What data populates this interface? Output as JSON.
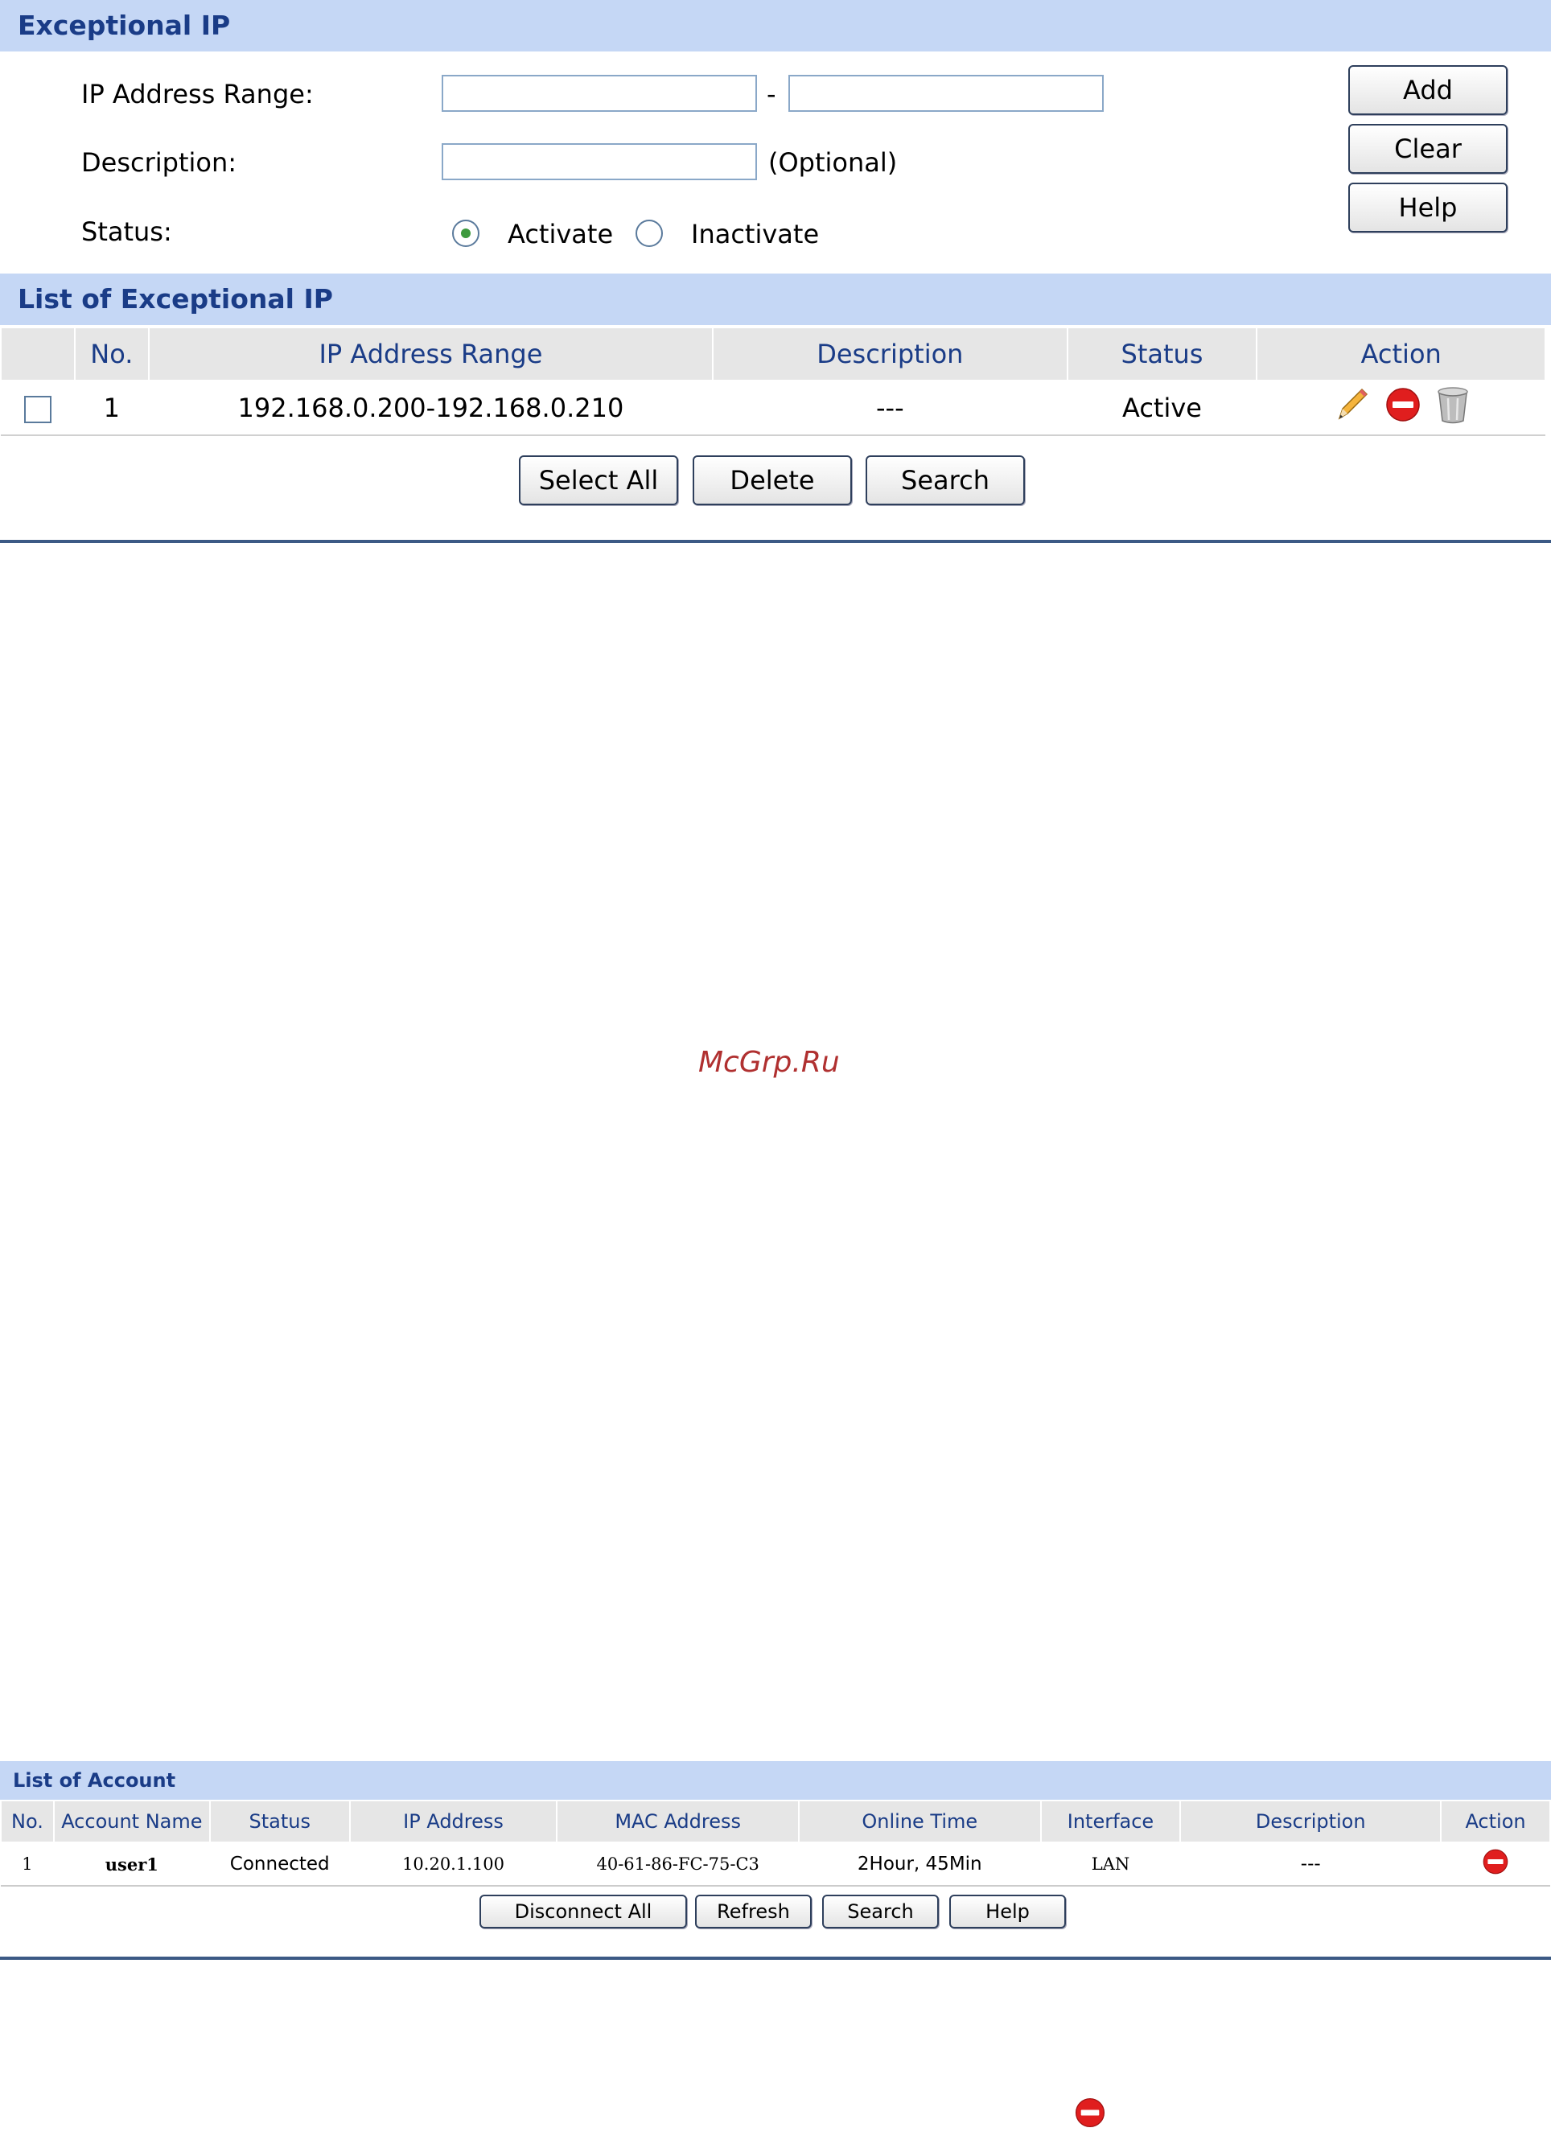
{
  "exceptional_ip": {
    "title": "Exceptional IP",
    "ip_range_label": "IP Address Range:",
    "range_dash": "-",
    "ip_start_value": "",
    "ip_end_value": "",
    "description_label": "Description:",
    "description_value": "",
    "optional_hint": "(Optional)",
    "status_label": "Status:",
    "status_options": [
      "Activate",
      "Inactivate"
    ],
    "status_selected": "Activate",
    "buttons": {
      "add": "Add",
      "clear": "Clear",
      "help": "Help"
    }
  },
  "exceptional_list": {
    "title": "List of Exceptional IP",
    "columns": [
      "",
      "No.",
      "IP Address Range",
      "Description",
      "Status",
      "Action"
    ],
    "rows": [
      {
        "no": "1",
        "ip_range": "192.168.0.200-192.168.0.210",
        "description": "---",
        "status": "Active",
        "actions": [
          "edit-icon",
          "disable-icon",
          "delete-icon"
        ]
      }
    ],
    "buttons": {
      "select_all": "Select All",
      "delete": "Delete",
      "search": "Search"
    }
  },
  "watermark": "McGrp.Ru",
  "account_list": {
    "title": "List of Account",
    "columns": [
      "No.",
      "Account Name",
      "Status",
      "IP Address",
      "MAC Address",
      "Online Time",
      "Interface",
      "Description",
      "Action"
    ],
    "rows": [
      {
        "no": "1",
        "account_name": "user1",
        "status": "Connected",
        "ip": "10.20.1.100",
        "mac": "40-61-86-FC-75-C3",
        "online_time": "2Hour, 45Min",
        "interface": "LAN",
        "description": "---",
        "actions": [
          "disconnect-icon"
        ]
      }
    ],
    "buttons": {
      "disconnect_all": "Disconnect All",
      "refresh": "Refresh",
      "search": "Search",
      "help": "Help"
    }
  },
  "colors": {
    "header_bg": "#c5d7f5",
    "header_text": "#1a3c87",
    "divider": "#3c5a85",
    "radio_selected": "#3e9a3e",
    "icon_red": "#e01e1e"
  }
}
